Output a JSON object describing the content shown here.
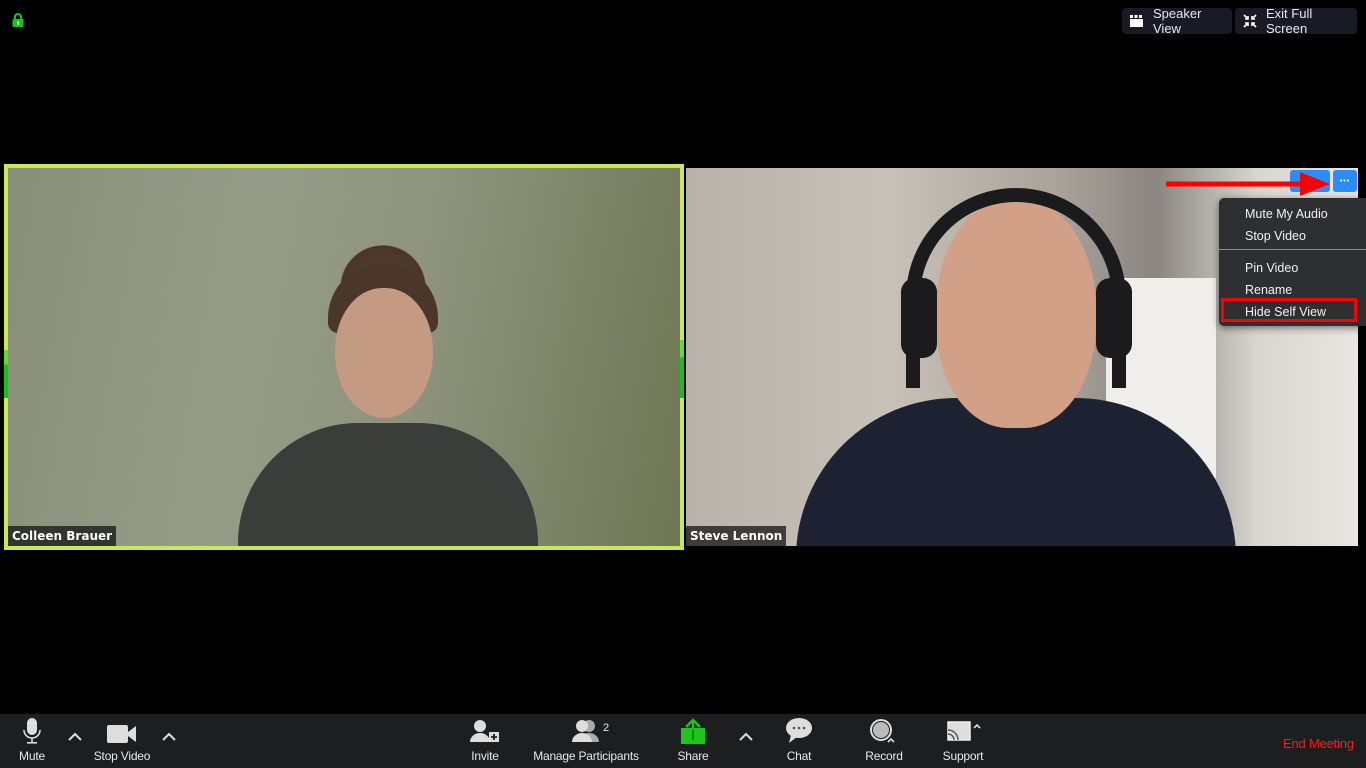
{
  "window": {
    "security_icon": "lock-icon",
    "security_color": "#18c418"
  },
  "top_controls": {
    "speaker_view": {
      "label": "Speaker View",
      "icon": "speaker-view-icon"
    },
    "exit_full_screen": {
      "label": "Exit Full Screen",
      "icon": "exit-full-screen-icon"
    }
  },
  "participants": [
    {
      "name": "Colleen Brauer",
      "active_speaker": true,
      "border_color": "#c8e85a"
    },
    {
      "name": "Steve Lennon",
      "active_speaker": false
    }
  ],
  "tile_menu": {
    "more_button": "•••",
    "items": [
      {
        "label": "Mute My Audio"
      },
      {
        "label": "Stop Video"
      },
      {
        "label": "Pin Video"
      },
      {
        "label": "Rename"
      },
      {
        "label": "Hide Self View",
        "highlighted": true
      }
    ]
  },
  "annotation": {
    "arrow_color": "#ff0000",
    "highlight_color": "#ff0000"
  },
  "toolbar": {
    "mute": {
      "label": "Mute",
      "icon": "microphone-icon"
    },
    "stop_video": {
      "label": "Stop Video",
      "icon": "video-camera-icon"
    },
    "invite": {
      "label": "Invite",
      "icon": "invite-icon"
    },
    "manage_participants": {
      "label": "Manage Participants",
      "icon": "participants-icon",
      "count": "2"
    },
    "share": {
      "label": "Share",
      "icon": "share-screen-icon",
      "color": "#19c819"
    },
    "chat": {
      "label": "Chat",
      "icon": "chat-icon"
    },
    "record": {
      "label": "Record",
      "icon": "record-icon"
    },
    "support": {
      "label": "Support",
      "icon": "support-icon"
    },
    "end_meeting": {
      "label": "End Meeting",
      "color": "#ff1a1a"
    }
  }
}
